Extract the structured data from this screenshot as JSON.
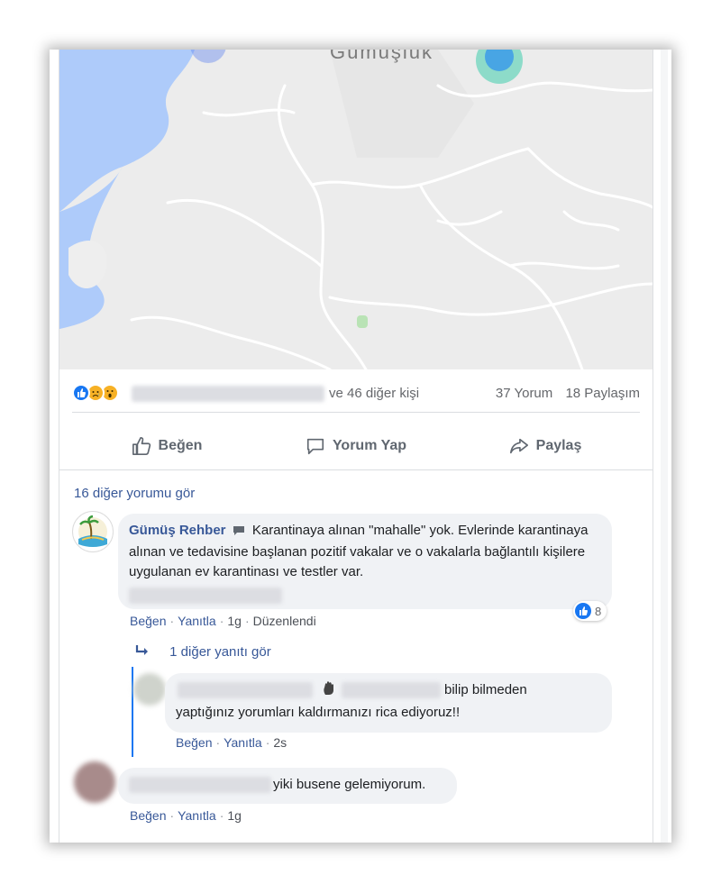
{
  "map": {
    "place_label": "Gümüşlük"
  },
  "reactions": {
    "icons": [
      "like-icon",
      "sad-icon",
      "wow-icon"
    ],
    "others_text": "ve 46 diğer kişi",
    "comments_count": "37 Yorum",
    "shares_count": "18 Paylaşım"
  },
  "actions": {
    "like": "Beğen",
    "comment": "Yorum Yap",
    "share": "Paylaş"
  },
  "more_comments": "16 diğer yorumu gör",
  "comment1": {
    "author": "Gümüş Rehber",
    "text": "Karantinaya alınan \"mahalle\" yok. Evlerinde karantinaya alınan ve tedavisine başlanan pozitif vakalar ve o vakalarla bağlantılı kişilere uygulanan ev karantinası ve testler var.",
    "like": "Beğen",
    "reply": "Yanıtla",
    "time": "1g",
    "edited": "Düzenlendi",
    "likes_count": "8"
  },
  "view_replies": "1 diğer yanıtı gör",
  "reply1": {
    "text_tail": "bilip bilmeden",
    "text_line2": "yaptığınız yorumları kaldırmanızı rica ediyoruz!!",
    "like": "Beğen",
    "reply": "Yanıtla",
    "time": "2s"
  },
  "comment2": {
    "text_tail": "yiki busene gelemiyorum.",
    "like": "Beğen",
    "reply": "Yanıtla",
    "time": "1g"
  },
  "colors": {
    "link": "#385898",
    "facebook_blue": "#1877f2",
    "bubble": "#f0f2f5",
    "map_water": "#aecbfa",
    "map_land": "#eeeeee"
  }
}
